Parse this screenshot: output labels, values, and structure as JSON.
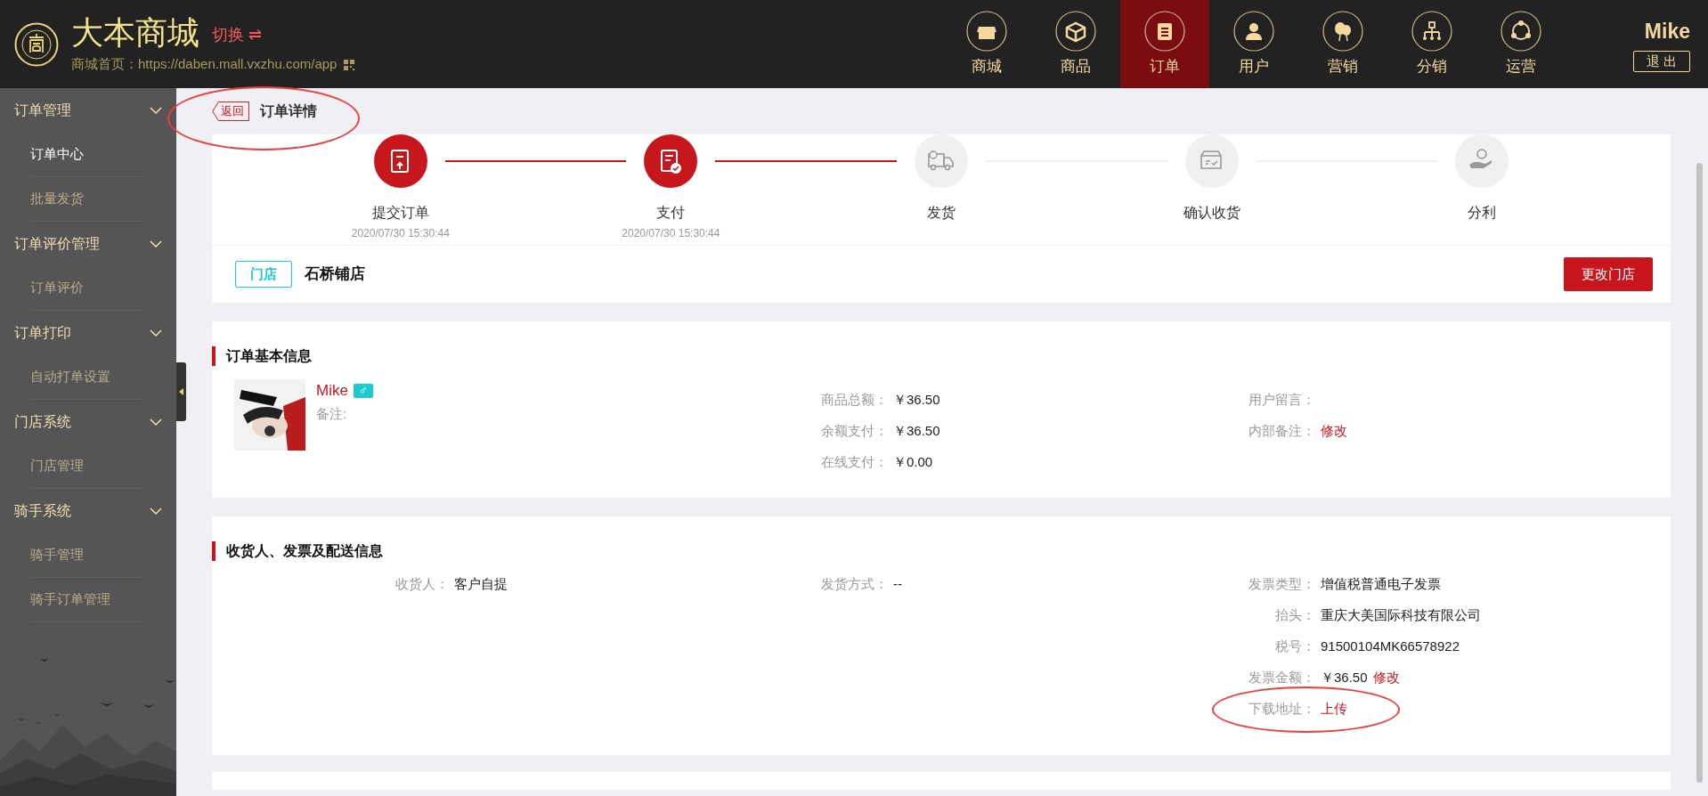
{
  "header": {
    "title": "大本商城",
    "switch": "切换 ⇌",
    "home_url": "商城首页：https://daben.mall.vxzhu.com/app"
  },
  "nav": [
    {
      "label": "商城",
      "selected": false
    },
    {
      "label": "商品",
      "selected": false
    },
    {
      "label": "订单",
      "selected": true
    },
    {
      "label": "用户",
      "selected": false
    },
    {
      "label": "营销",
      "selected": false
    },
    {
      "label": "分销",
      "selected": false
    },
    {
      "label": "运营",
      "selected": false
    }
  ],
  "user": {
    "name": "Mike",
    "logout": "退 出"
  },
  "sidebar": [
    {
      "label": "订单管理",
      "expanded": true,
      "children": [
        {
          "label": "订单中心",
          "selected": true
        },
        {
          "label": "批量发货",
          "selected": false
        }
      ]
    },
    {
      "label": "订单评价管理",
      "expanded": true,
      "children": [
        {
          "label": "订单评价",
          "selected": false
        }
      ]
    },
    {
      "label": "订单打印",
      "expanded": true,
      "children": [
        {
          "label": "自动打单设置",
          "selected": false
        }
      ]
    },
    {
      "label": "门店系统",
      "expanded": true,
      "children": [
        {
          "label": "门店管理",
          "selected": false
        }
      ]
    },
    {
      "label": "骑手系统",
      "expanded": true,
      "children": [
        {
          "label": "骑手管理",
          "selected": false
        },
        {
          "label": "骑手订单管理",
          "selected": false
        }
      ]
    }
  ],
  "breadcrumb": {
    "back": "返回",
    "title": "订单详情",
    "circled": true
  },
  "steps": [
    {
      "label": "提交订单",
      "time": "2020/07/30 15:30:44",
      "done": true
    },
    {
      "label": "支付",
      "time": "2020/07/30 15:30:44",
      "done": true
    },
    {
      "label": "发货",
      "done": false
    },
    {
      "label": "确认收货",
      "done": false
    },
    {
      "label": "分利",
      "done": false
    }
  ],
  "store": {
    "tag": "门店",
    "name": "石桥铺店",
    "button": "更改门店"
  },
  "basic_info": {
    "title": "订单基本信息",
    "customer": {
      "name": "Mike",
      "gender": "♂",
      "note": "备注:"
    },
    "columns": [
      [
        {
          "label": "商品总额：",
          "value": "￥36.50"
        },
        {
          "label": "余额支付：",
          "value": "￥36.50"
        },
        {
          "label": "在线支付：",
          "value": "￥0.00"
        }
      ],
      [
        {
          "label": "用户留言："
        },
        {
          "label": "内部备注：",
          "link": "修改"
        }
      ]
    ]
  },
  "delivery_info": {
    "title": "收货人、发票及配送信息",
    "columns": [
      [
        {
          "label": "收货人：",
          "value": "客户自提"
        }
      ],
      [
        {
          "label": "发货方式：",
          "value": "--"
        }
      ],
      [
        {
          "label": "发票类型：",
          "value": "增值税普通电子发票"
        },
        {
          "label": "抬头：",
          "value": "重庆大美国际科技有限公司"
        },
        {
          "label": "税号：",
          "value": "91500104MK66578922"
        },
        {
          "label": "发票金额：",
          "value": "￥36.50",
          "link": "修改"
        },
        {
          "label": "下载地址：",
          "link": "上传",
          "circled": true
        }
      ]
    ]
  }
}
